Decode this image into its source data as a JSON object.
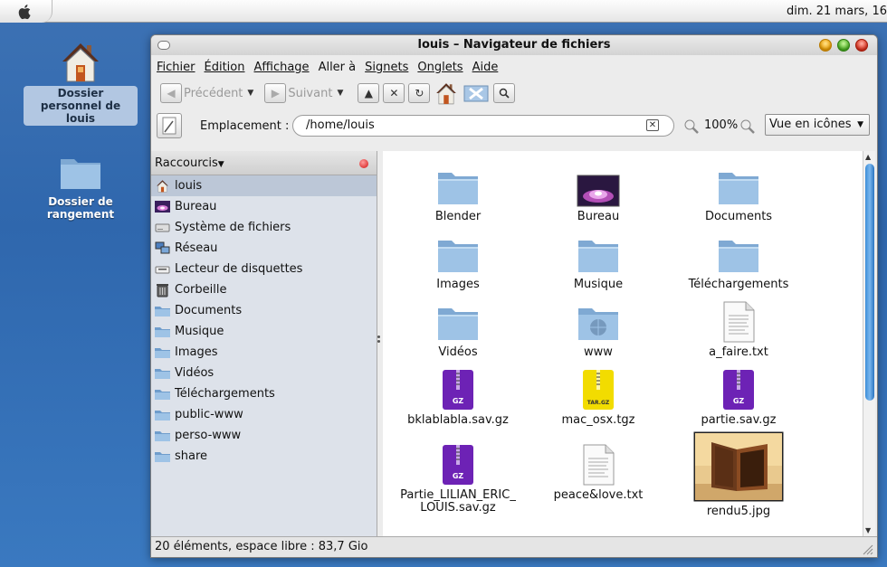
{
  "topbar": {
    "clock": "dim. 21 mars, 16"
  },
  "desktop": {
    "icons": [
      {
        "label": "Dossier personnel de louis"
      },
      {
        "label": "Dossier de rangement"
      }
    ]
  },
  "window": {
    "title": "louis – Navigateur de fichiers",
    "menu": [
      "Fichier",
      "Édition",
      "Affichage",
      "Aller à",
      "Signets",
      "Onglets",
      "Aide"
    ],
    "toolbar": {
      "back_label": "Précédent",
      "forward_label": "Suivant"
    },
    "location": {
      "label": "Emplacement :",
      "value": "/home/louis",
      "zoom": "100%",
      "view_mode": "Vue en icônes"
    },
    "sidebar": {
      "header": "Raccourcis",
      "items": [
        {
          "label": "louis",
          "icon": "home-icon"
        },
        {
          "label": "Bureau",
          "icon": "desktop-icon"
        },
        {
          "label": "Système de fichiers",
          "icon": "harddisk-icon"
        },
        {
          "label": "Réseau",
          "icon": "network-icon"
        },
        {
          "label": "Lecteur de disquettes",
          "icon": "floppy-drive-icon"
        },
        {
          "label": "Corbeille",
          "icon": "trash-icon"
        },
        {
          "label": "Documents",
          "icon": "folder-icon"
        },
        {
          "label": "Musique",
          "icon": "folder-icon"
        },
        {
          "label": "Images",
          "icon": "folder-icon"
        },
        {
          "label": "Vidéos",
          "icon": "folder-icon"
        },
        {
          "label": "Téléchargements",
          "icon": "folder-icon"
        },
        {
          "label": "public-www",
          "icon": "folder-icon"
        },
        {
          "label": "perso-www",
          "icon": "folder-icon"
        },
        {
          "label": "share",
          "icon": "folder-icon"
        }
      ]
    },
    "files": [
      {
        "name": "Blender",
        "type": "folder"
      },
      {
        "name": "Bureau",
        "type": "desktop-folder"
      },
      {
        "name": "Documents",
        "type": "folder"
      },
      {
        "name": "Images",
        "type": "folder"
      },
      {
        "name": "Musique",
        "type": "folder"
      },
      {
        "name": "Téléchargements",
        "type": "folder"
      },
      {
        "name": "Vidéos",
        "type": "folder"
      },
      {
        "name": "www",
        "type": "web-folder"
      },
      {
        "name": "a_faire.txt",
        "type": "text"
      },
      {
        "name": "bklablabla.sav.gz",
        "type": "gz-archive"
      },
      {
        "name": "mac_osx.tgz",
        "type": "tgz-archive"
      },
      {
        "name": "partie.sav.gz",
        "type": "gz-archive"
      },
      {
        "name": "Partie_LILIAN_ERIC_\nLOUIS.sav.gz",
        "type": "gz-archive"
      },
      {
        "name": "peace&love.txt",
        "type": "text"
      },
      {
        "name": "rendu5.jpg",
        "type": "image"
      }
    ],
    "status": "20 éléments, espace libre : 83,7 Gio"
  },
  "colors": {
    "desktop": "#2f67ad",
    "selection": "#bcc7d7",
    "folder": "#8fb7dc",
    "archive": "#6d22b5"
  }
}
